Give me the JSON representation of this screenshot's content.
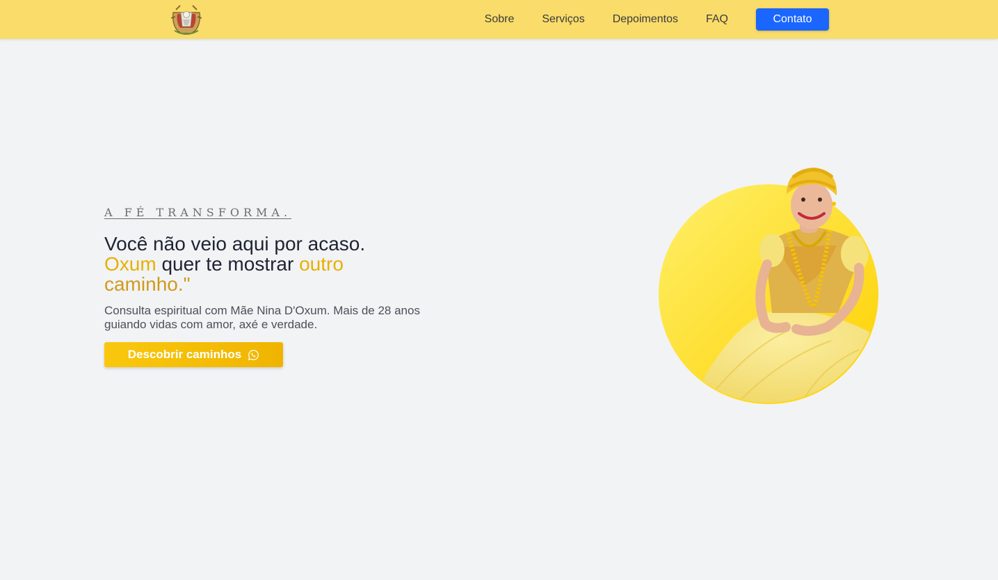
{
  "header": {
    "logo_icon": "coat-of-arms-logo",
    "nav": [
      {
        "label": "Sobre"
      },
      {
        "label": "Serviços"
      },
      {
        "label": "Depoimentos"
      },
      {
        "label": "FAQ"
      }
    ],
    "contact_label": "Contato"
  },
  "hero": {
    "eyebrow": "A FÉ TRANSFORMA.",
    "headline": {
      "line1": "Você não veio aqui por acaso.",
      "oxum": "Oxum",
      "middle": " quer te mostrar ",
      "outro": "outro",
      "caminho": "caminho.\""
    },
    "subtitle": "Consulta espiritual com Mãe Nina D'Oxum. Mais de 28 anos guiando vidas com amor, axé e verdade.",
    "cta_label": "Descobrir caminhos",
    "cta_icon": "whatsapp-icon",
    "portrait_icon": "portrait-woman-yellow-dress"
  },
  "colors": {
    "header_bg": "#f9dc6a",
    "page_bg": "#f2f3f5",
    "contact_button": "#1a66ff",
    "cta_gold": "#f9c80e",
    "headline_gold": "#e6b100",
    "headline_ochre": "#d09a1c"
  }
}
